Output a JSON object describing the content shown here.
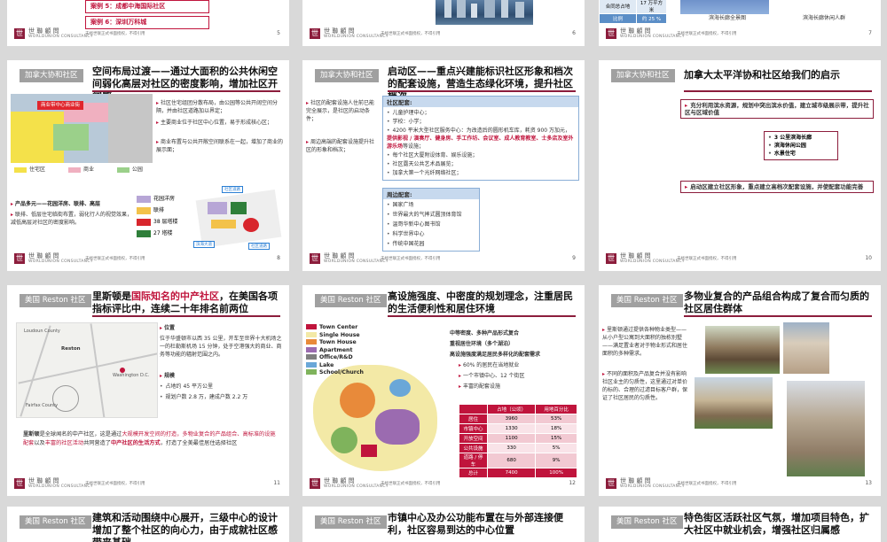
{
  "brand": {
    "logo_mark": "世",
    "logo_name": "世 聯 顧 問",
    "logo_sub": "WORLDUNION CONSULTANCY",
    "footer_note": "未经世联正式书面授权，不得引用"
  },
  "colors": {
    "accent": "#8c1d3c",
    "red": "#c0143c",
    "tag": "#a0a0a0"
  },
  "s5": {
    "case5": "案例 5：成都中海国际社区",
    "case6": "案例 6：深圳万科城",
    "page": "5"
  },
  "s6": {
    "page": "6"
  },
  "s7": {
    "table_rows": [
      [
        "合同总占地",
        "17 万平方米"
      ],
      [
        "比例",
        "约 25 %"
      ]
    ],
    "caption1": "滨海长廊全景图",
    "caption2": "滨海长廊休闲人群",
    "page": "7"
  },
  "s8": {
    "tag": "加拿大协和社区",
    "title": "空间布局过渡——通过大面积的公共休闲空间弱化高层对社区的密度影响，增加社区开阔感",
    "map_label": "商业带中心商业街",
    "legend": [
      "住宅区",
      "商业",
      "公园"
    ],
    "bullets": [
      "社区住宅组团分散布局，由公园等公共开阔空间分隔，并由社区道路加以界定；",
      "主要商业位于社区中心位置，易于形成核心区；",
      "商业布置与公共开敞空间联系在一起，增加了商业的展示面；"
    ],
    "product_title": "产品多元——花园洋房、联排、高层",
    "product_text": "联排、低层住宅临街布置，弱化行人的视觉效果，减低高层对社区的密度影响。",
    "legend2": [
      "花园洋房",
      "联排",
      "38 层塔楼",
      "27 塔楼"
    ],
    "road_labels": [
      "社区道路",
      "滨海大道",
      "社区道路"
    ],
    "page": "8"
  },
  "s9": {
    "tag": "加拿大协和社区",
    "title": "启动区——重点兴建能标识社区形象和档次的配套设施，营造生态绿化环境，提升社区档次",
    "left_text": [
      "社区的配套设施人住前已能完全展示，是社区的启动条件；",
      "周边高端的配套设施提升社区的形象和档次；"
    ],
    "sec1_title": "社区配套:",
    "sec1_items": [
      "儿童护理中心；",
      "学校：小学；",
      "4200 平米大型社区服务中心：为改造后的圆形机车库，耗资 900 万加元，",
      "每个社区大厦附设体育、娱乐设施；",
      "社区露天公共艺术品展览；",
      "加拿大第一个光纤网络社区；"
    ],
    "sec1_highlight": "提供影视 / 演奏厅、健身房、手工作坊、会议室、成人教育教室、士多店及室外游乐场",
    "sec1_highlight_suffix": "等设施；",
    "sec2_title": "周边配套:",
    "sec2_items": [
      "国家广场",
      "世界最大的气摔式圆顶体育馆",
      "温哥华新中心图书馆",
      "科学世界中心",
      "传统中国花园"
    ],
    "page": "9"
  },
  "s10": {
    "tag": "加拿大协和社区",
    "title": "加拿大太平洋协和社区给我们的启示",
    "call1": "充分利用滨水资源，规划中突出滨水价值，建立城市级展示带，提升社区与区域价值",
    "list": [
      "3 公里滨海长廊",
      "滨海休闲公园",
      "水景住宅"
    ],
    "call2": "启动区建立社区形象，重点建立高档次配套设施，并使配套功能完善",
    "page": "10"
  },
  "s11": {
    "tag": "美国 Reston 社区",
    "title_a": "里斯顿是",
    "title_hl": "国际知名的中产社区",
    "title_b": "，在美国各项指标评比中，连续二十年排名前两位",
    "loc_title": "位置",
    "loc_text": "位于华盛顿市以西 35 公里，开车至世界十大机场之一的杜勒斯机场 15 分钟，处于空港强大的商业、商务等功能的辐射范围之内。",
    "scale_title": "规模",
    "scale_items": [
      "占地约 45 平方公里",
      "规划户数 2.8 万，建成户数 2.2 万"
    ],
    "bottom_a": "里斯顿",
    "bottom_b": "是全球闻名的中产社区，这是通过",
    "bottom_c": "大规模开发空间",
    "bottom_d": "的打造，多物业复合的产品组合、高标准的设施配套",
    "bottom_e": "以及",
    "bottom_f": "丰富的社区活动",
    "bottom_g": "共同营造了",
    "bottom_h": "中产社区的生活方式",
    "bottom_i": "，打造了全美最佳居住选择社区",
    "map_labels": [
      "Loudoun County",
      "Reston",
      "Fairfax County",
      "Washington D.C."
    ],
    "page": "11"
  },
  "s12": {
    "tag": "美国 Reston 社区",
    "title": "高设施强度、中密度的规划理念，注重居民的生活便利性和居住环境",
    "legend": [
      "Town Center",
      "Single House",
      "Town House",
      "Apartment",
      "Office/R&D",
      "Lake",
      "School/Church"
    ],
    "h1": "中等密度、多种产品形式复合",
    "h2": "重视居住环境（多个湖泊）",
    "h3": "高设施强度满足居民多样化的配套需求",
    "items": [
      "60% 的居民在当地就业",
      "一个市镇中心、12 个街区",
      "丰富的配套设施"
    ],
    "table_head": [
      "",
      "占地（公顷）",
      "用地百分比"
    ],
    "table_rows": [
      [
        "居住",
        "3960",
        "53%"
      ],
      [
        "市镇中心",
        "1330",
        "18%"
      ],
      [
        "开放空间",
        "1100",
        "15%"
      ],
      [
        "公共设施",
        "330",
        "5%"
      ],
      [
        "道路 / 停车",
        "680",
        "9%"
      ],
      [
        "总计",
        "7400",
        "100%"
      ]
    ],
    "page": "12"
  },
  "s13": {
    "tag": "美国 Reston 社区",
    "title": "多物业复合的产品组合构成了复合而匀质的社区居住群体",
    "text": [
      "里斯顿通过提供各种物业类型——从小户型公寓到大面积的独栋别墅——满足置业者对于物业形式和居住面积的多种需求。",
      "不同的面积及产品复合并没有影响社区业主的匀质性，这里通过对单价的标的、合理的过滤目标客户群，保证了社区居民的匀质性。"
    ],
    "page": "13"
  },
  "s14": {
    "tag": "美国 Reston 社区",
    "title": "建筑和活动围绕中心展开，三级中心的设计增加了整个社区的向心力，由于成就社区感带来基础"
  },
  "s15": {
    "tag": "美国 Reston 社区",
    "title": "市镇中心及办公功能布置在与外部连接便利，社区容易到达的中心位置"
  },
  "s16": {
    "tag": "美国 Reston 社区",
    "title": "特色街区活跃社区气氛，增加项目特色，扩大社区中就业机会，增强社区归属感"
  }
}
